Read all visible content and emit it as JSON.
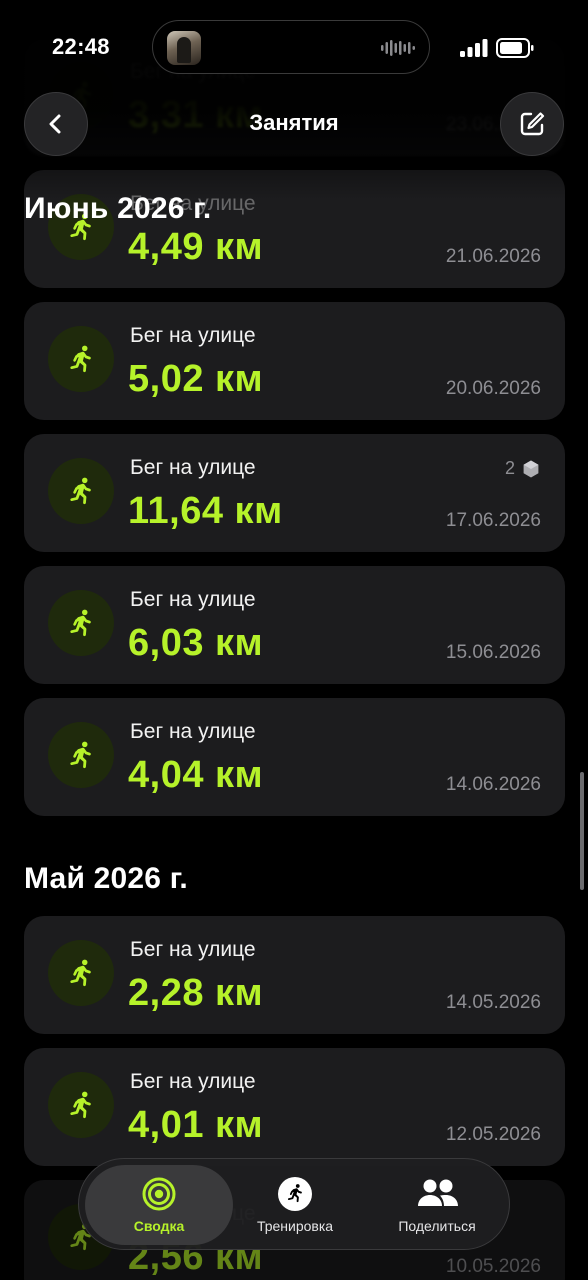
{
  "status_bar": {
    "time": "22:48"
  },
  "header": {
    "title": "Занятия"
  },
  "ghost_card": {
    "type": "Бег на улице",
    "distance": "3,31 км",
    "date": "23.06.2026"
  },
  "sections": [
    {
      "title": "Июнь 2026 г.",
      "items": [
        {
          "type": "Бег на улице",
          "distance": "4,49 км",
          "date": "21.06.2026"
        },
        {
          "type": "Бег на улице",
          "distance": "5,02 км",
          "date": "20.06.2026"
        },
        {
          "type": "Бег на улице",
          "distance": "11,64 км",
          "date": "17.06.2026",
          "badge_count": "2"
        },
        {
          "type": "Бег на улице",
          "distance": "6,03 км",
          "date": "15.06.2026"
        },
        {
          "type": "Бег на улице",
          "distance": "4,04 км",
          "date": "14.06.2026"
        }
      ]
    },
    {
      "title": "Май 2026 г.",
      "items": [
        {
          "type": "Бег на улице",
          "distance": "2,28 км",
          "date": "14.05.2026"
        },
        {
          "type": "Бег на улице",
          "distance": "4,01 км",
          "date": "12.05.2026"
        },
        {
          "type": "Бег на улице",
          "distance": "2,56 км",
          "date": "10.05.2026"
        }
      ]
    }
  ],
  "tab_bar": {
    "tabs": [
      {
        "label": "Сводка",
        "icon": "activity-rings-icon",
        "active": true
      },
      {
        "label": "Тренировка",
        "icon": "workout-runner-icon",
        "active": false
      },
      {
        "label": "Поделиться",
        "icon": "people-icon",
        "active": false
      }
    ]
  },
  "colors": {
    "accent": "#b6f22a",
    "card": "#1c1c1e",
    "secondary_text": "#8e8e93"
  }
}
